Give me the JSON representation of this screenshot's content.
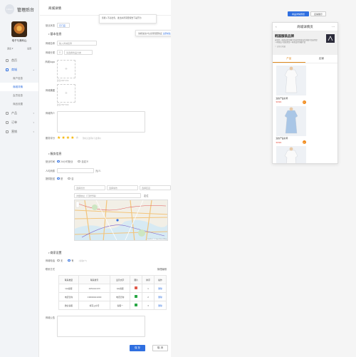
{
  "sidebar": {
    "logo_text": "LOGO",
    "title": "管理后台",
    "user_name": "电子与港科山",
    "user_actions": [
      "退出 ▾",
      "设置"
    ],
    "nav": [
      {
        "label": "首页"
      },
      {
        "label": "商城",
        "open": true,
        "children": [
          {
            "label": "商户信息"
          },
          {
            "label": "商城详情",
            "active": true
          },
          {
            "label": "会员信息"
          },
          {
            "label": "商品设置"
          }
        ]
      },
      {
        "label": "产品"
      },
      {
        "label": "订单"
      },
      {
        "label": "营销"
      }
    ]
  },
  "main": {
    "breadcrumb": "商城详情",
    "tooltip_top": "您能+不必出售，发出关闭需要报告下是否为",
    "tooltip_verify": {
      "text": "请修改商户信息所需要验证",
      "link": "立即前往"
    },
    "status": {
      "label": "营业状态",
      "value": "已门店"
    },
    "section_basic": "基本信息",
    "name": {
      "label": "商城名称",
      "placeholder": "输入商城名称"
    },
    "type": {
      "label": "商城分类",
      "value": "请选择商品分类"
    },
    "logo": {
      "label": "商城logo",
      "hint": "建议200*200"
    },
    "cover": {
      "label": "商城横图",
      "hint": "建议750*300"
    },
    "intro": {
      "label": "商城简介"
    },
    "rating": {
      "label": "服务评分",
      "stars": 4,
      "total": 5,
      "hint": "暂时无法评价下此评价"
    },
    "section_service": "服务信息",
    "business_hours": {
      "label": "营业时间",
      "options": [
        "24小时营业",
        "自定义"
      ],
      "selected": 0
    },
    "capacity": {
      "label": "人均消费",
      "value": "",
      "unit": "元/人"
    },
    "delivery": {
      "label": "提供配送",
      "options": [
        "是",
        "否"
      ],
      "selected": 0
    },
    "address": {
      "selects": [
        "选择省份",
        "选择城市",
        "选择区县"
      ],
      "detail_placeholder": "详细地址（门牌号等）",
      "locate": "定位"
    },
    "map": {
      "footer": "Leaflet | © OpenStreetMap"
    },
    "section_contact": "商家设置",
    "contact": {
      "label": "商城电话",
      "options": [
        "无",
        "有"
      ],
      "selected": 1,
      "hint": "(可填1个)"
    },
    "contact_table_label": "联系方式",
    "contact_table_btn": "管理编辑",
    "table": {
      "headers": [
        "联系类型",
        "联系账号",
        "显示文字",
        "图片",
        "排序",
        "操作"
      ],
      "rows": [
        {
          "type": "QQ客服",
          "account": "245412133",
          "show": "QQ客服",
          "icon_color": "#e05a4a",
          "sort": "1",
          "op": "删除"
        },
        {
          "type": "电话咨询",
          "account": "19999441000",
          "show": "电话咨询",
          "icon_color": "#28a745",
          "sort": "2",
          "op": "删除"
        },
        {
          "type": "微信客服",
          "account": "填写公众号",
          "show": "客服一",
          "icon_color": "#28a745",
          "sort": "3",
          "op": "删除"
        }
      ]
    },
    "remark": {
      "label": "商城公告"
    },
    "save_label": "保 存",
    "cancel_label": "取 消"
  },
  "preview": {
    "btn_primary": "商品详情预览",
    "btn_secondary": "店铺展示",
    "header_title": "商城详情页",
    "banner_title": "韩国服装品牌",
    "banner_desc": "这里是一些商品的详细介绍这里是商品的详细介绍这里是一些商品介绍这里是一些商品的详细介绍",
    "banner_sub": "☆ 店铺已收藏",
    "tabs": [
      "产品",
      "店铺"
    ],
    "active_tab": 0,
    "products": [
      {
        "name": "连衣产品名称",
        "price": "¥299"
      },
      {
        "name": "连衣产品名称",
        "price": "¥299"
      },
      {
        "name": "",
        "price": ""
      },
      {
        "name": "",
        "price": ""
      }
    ]
  },
  "colors": {
    "primary": "#2f6fe0",
    "accent": "#e08a1e",
    "price": "#e03a2a"
  }
}
